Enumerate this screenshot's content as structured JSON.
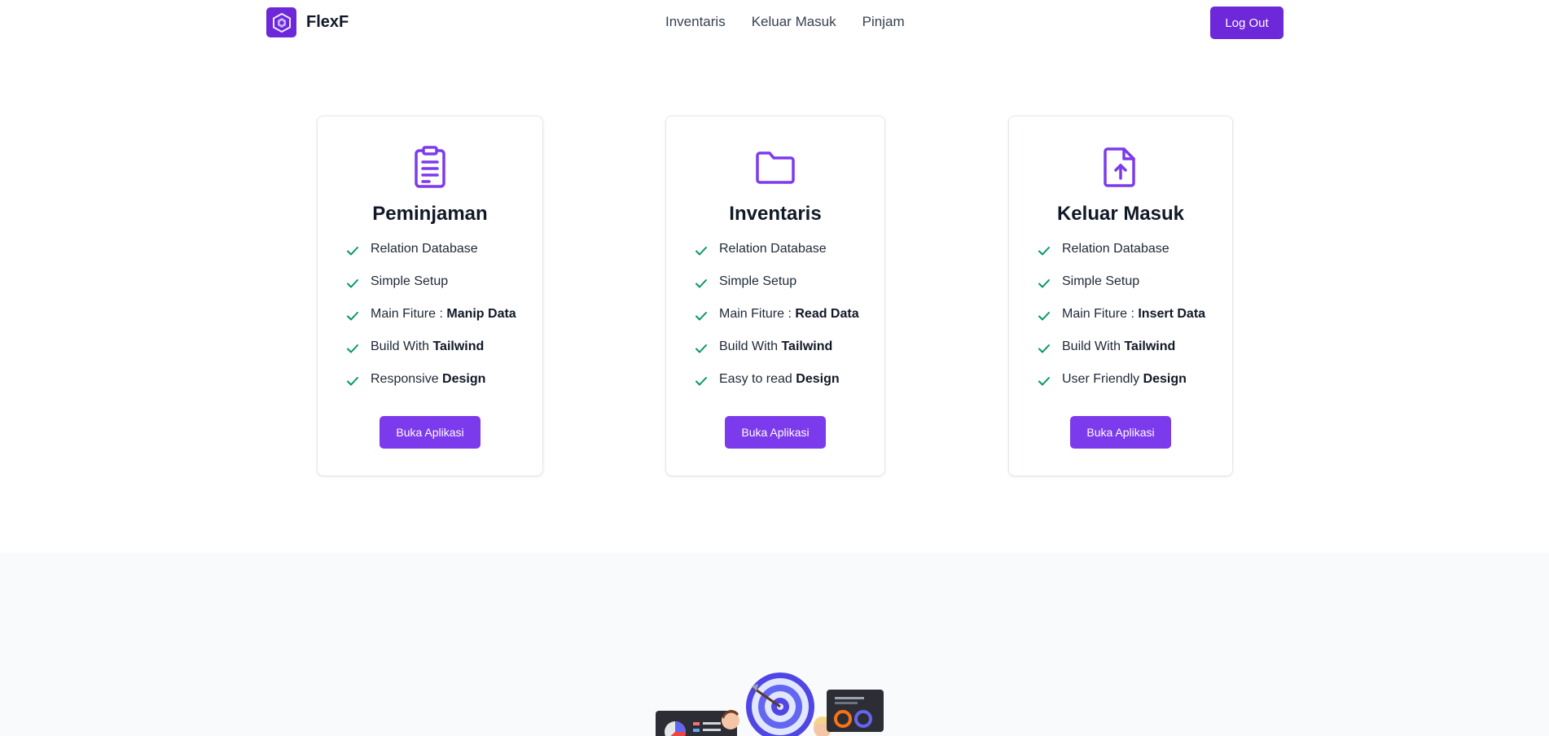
{
  "header": {
    "brand": "FlexF",
    "nav": [
      "Inventaris",
      "Keluar Masuk",
      "Pinjam"
    ],
    "logout_label": "Log Out"
  },
  "colors": {
    "accent": "#7c3aed",
    "brand": "#6d28d9",
    "check": "#059669",
    "section_bg": "#f9fafb"
  },
  "cards": [
    {
      "icon": "clipboard-icon",
      "title": "Peminjaman",
      "features": [
        {
          "text": "Relation Database",
          "bold": ""
        },
        {
          "text": "Simple Setup",
          "bold": ""
        },
        {
          "text": "Main Fiture : ",
          "bold": "Manip Data"
        },
        {
          "text": "Build With ",
          "bold": "Tailwind"
        },
        {
          "text": "Responsive ",
          "bold": "Design"
        }
      ],
      "button": "Buka Aplikasi"
    },
    {
      "icon": "folder-icon",
      "title": "Inventaris",
      "features": [
        {
          "text": "Relation Database",
          "bold": ""
        },
        {
          "text": "Simple Setup",
          "bold": ""
        },
        {
          "text": "Main Fiture : ",
          "bold": "Read Data"
        },
        {
          "text": "Build With ",
          "bold": "Tailwind"
        },
        {
          "text": "Easy to read ",
          "bold": "Design"
        }
      ],
      "button": "Buka Aplikasi"
    },
    {
      "icon": "file-upload-icon",
      "title": "Keluar Masuk",
      "features": [
        {
          "text": "Relation Database",
          "bold": ""
        },
        {
          "text": "Simple Setup",
          "bold": ""
        },
        {
          "text": "Main Fiture : ",
          "bold": "Insert Data"
        },
        {
          "text": "Build With ",
          "bold": "Tailwind"
        },
        {
          "text": "User Friendly ",
          "bold": "Design"
        }
      ],
      "button": "Buka Aplikasi"
    }
  ]
}
